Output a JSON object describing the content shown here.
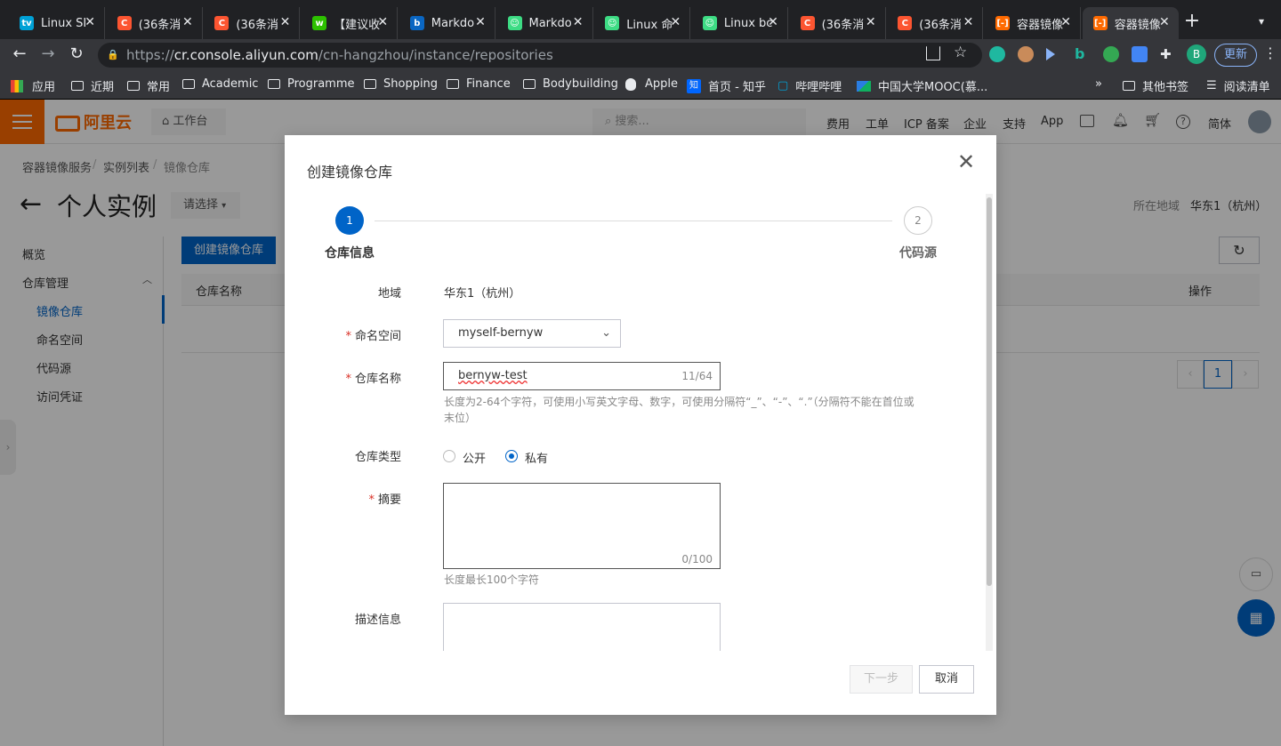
{
  "browser": {
    "tabs": [
      {
        "title": "Linux SI",
        "fav": "bilibili-icon",
        "color": "#00a1d6"
      },
      {
        "title": "(36条消",
        "fav": "csdn-icon",
        "color": "#fc5531"
      },
      {
        "title": "(36条消",
        "fav": "csdn-icon",
        "color": "#fc5531"
      },
      {
        "title": "【建议收",
        "fav": "wechat-icon",
        "color": "#2dc100"
      },
      {
        "title": "Markdo",
        "fav": "bing-icon",
        "color": "#0a66c2"
      },
      {
        "title": "Markdo",
        "fav": "robot-icon",
        "color": "#3ddc84"
      },
      {
        "title": "Linux 命",
        "fav": "robot-icon",
        "color": "#3ddc84"
      },
      {
        "title": "Linux bc",
        "fav": "robot-icon",
        "color": "#3ddc84"
      },
      {
        "title": "(36条消",
        "fav": "csdn-icon",
        "color": "#fc5531"
      },
      {
        "title": "(36条消",
        "fav": "csdn-icon",
        "color": "#fc5531"
      },
      {
        "title": "容器镜像",
        "fav": "aliyun-icon",
        "color": "#ff6a00"
      },
      {
        "title": "容器镜像",
        "fav": "aliyun-icon",
        "color": "#ff6a00"
      }
    ],
    "url_host": "cr.console.aliyun.com",
    "url_prefix": "https://",
    "url_path": "/cn-hangzhou/instance/repositories",
    "update_label": "更新",
    "profile_letter": "B",
    "bookmarks": [
      "应用",
      "近期",
      "常用",
      "Academic",
      "Programme",
      "Shopping",
      "Finance",
      "Bodybuilding",
      "Apple",
      "首页 - 知乎",
      "哔哩哔哩",
      "中国大学MOOC(慕...",
      "»",
      "其他书签",
      "阅读清单"
    ]
  },
  "console": {
    "logo": "阿里云",
    "workbench": "工作台",
    "search_placeholder": "搜索...",
    "nav": [
      "费用",
      "工单",
      "ICP 备案",
      "企业",
      "支持",
      "App",
      "简体"
    ],
    "breadcrumb": [
      "容器镜像服务",
      "/",
      "实例列表",
      "/",
      "镜像仓库"
    ],
    "page_title": "个人实例",
    "select_label": "请选择",
    "region_label": "所在地域",
    "region_value": "华东1（杭州）",
    "create_button": "创建镜像仓库",
    "table_headers": [
      "仓库名称",
      "操作"
    ],
    "page_number": "1",
    "sidebar": {
      "overview": "概览",
      "repo_mgmt": "仓库管理",
      "items": [
        "镜像仓库",
        "命名空间",
        "代码源",
        "访问凭证"
      ]
    }
  },
  "modal": {
    "title": "创建镜像仓库",
    "steps": [
      {
        "num": "1",
        "label": "仓库信息"
      },
      {
        "num": "2",
        "label": "代码源"
      }
    ],
    "region_label": "地域",
    "region_value": "华东1（杭州）",
    "namespace_label": "命名空间",
    "namespace_value": "myself-bernyw",
    "repo_name_label": "仓库名称",
    "repo_name_value": "bernyw-test",
    "repo_name_count": "11/64",
    "repo_name_hint": "长度为2-64个字符，可使用小写英文字母、数字，可使用分隔符“_”、“-”、“.”（分隔符不能在首位或末位）",
    "repo_type_label": "仓库类型",
    "repo_type_options": [
      "公开",
      "私有"
    ],
    "repo_type_selected": "私有",
    "summary_label": "摘要",
    "summary_count": "0/100",
    "summary_hint": "长度最长100个字符",
    "desc_label": "描述信息",
    "next_button": "下一步",
    "cancel_button": "取消"
  }
}
